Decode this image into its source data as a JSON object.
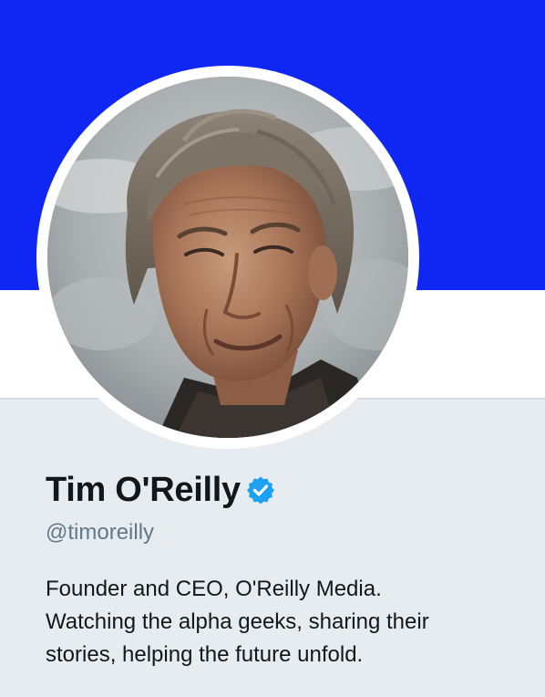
{
  "profile": {
    "display_name": "Tim O'Reilly",
    "handle": "@timoreilly",
    "verified": true,
    "bio_lines": [
      "Founder and CEO, O'Reilly Media.",
      "Watching the alpha geeks, sharing their",
      "stories, helping the future unfold."
    ]
  },
  "colors": {
    "banner": "#1027f4",
    "info_panel": "#e6ecf0",
    "verified_badge": "#1da1f2",
    "name_text": "#14171a",
    "handle_text": "#657786"
  },
  "icons": {
    "verified": "verified-badge-icon",
    "avatar": "profile-photo"
  }
}
